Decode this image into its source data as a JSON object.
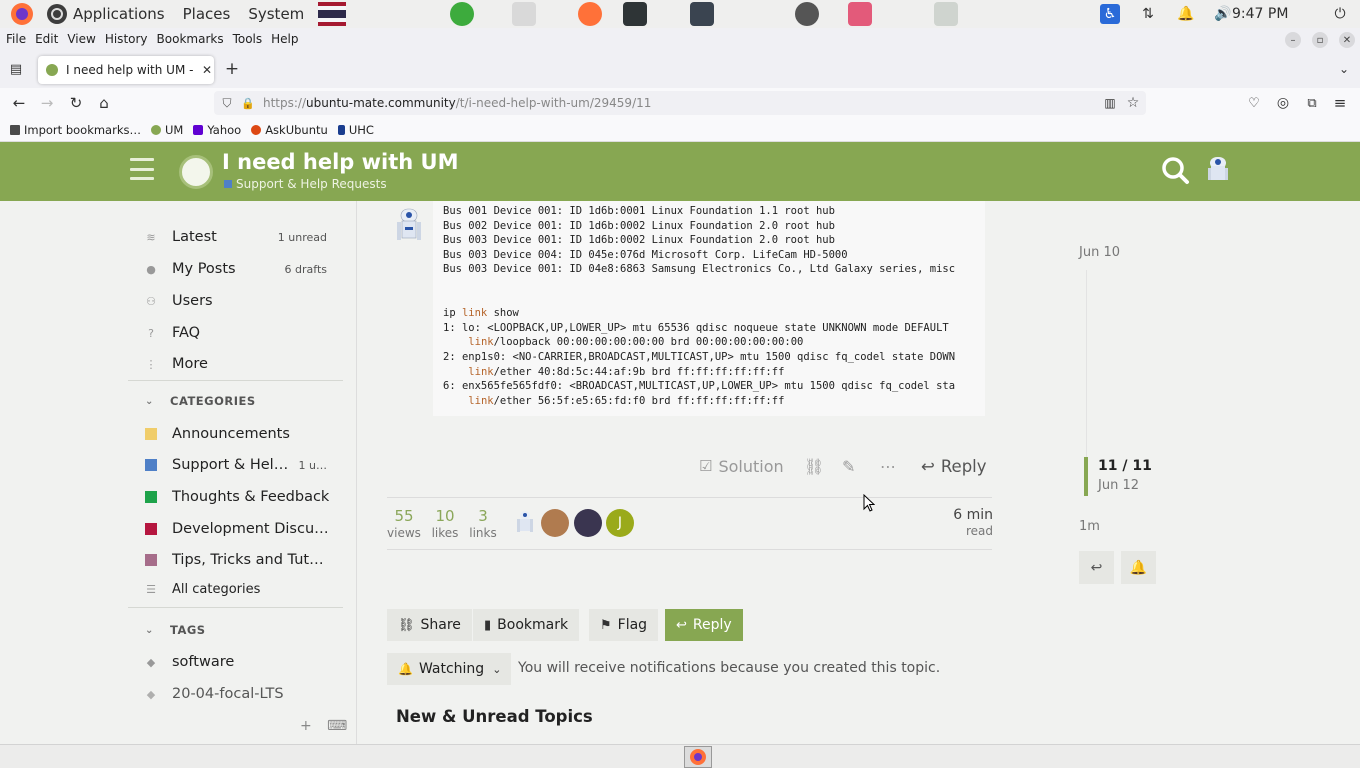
{
  "system_panel": {
    "menus": [
      "Applications",
      "Places",
      "System"
    ],
    "clock": "9:47 PM",
    "launchers": [
      "screen-switcher-icon",
      "sensors-icon",
      "firefox-icon",
      "terminal-icon",
      "system-monitor-icon",
      "software-updater-icon",
      "usb-creator-icon",
      "recycle-icon"
    ],
    "tray": [
      "accessibility-icon",
      "network-icon",
      "notifications-icon",
      "volume-icon",
      "power-icon"
    ]
  },
  "firefox": {
    "menubar": [
      "File",
      "Edit",
      "View",
      "History",
      "Bookmarks",
      "Tools",
      "Help"
    ],
    "tab_title": "I need help with UM - Support & Help Requests",
    "url_prefix": "https://",
    "url_domain": "ubuntu-mate.community",
    "url_path": "/t/i-need-help-with-um/29459/11",
    "bookmarks": [
      {
        "label": "Import bookmarks…",
        "color": "#4a4a4a"
      },
      {
        "label": "UM",
        "color": "#87a752"
      },
      {
        "label": "Yahoo",
        "color": "#6001d2"
      },
      {
        "label": "AskUbuntu",
        "color": "#dd4814"
      },
      {
        "label": "UHC",
        "color": "#1a3d8f"
      }
    ]
  },
  "header": {
    "title": "I need help with UM",
    "category": "Support & Help Requests",
    "accent": "#87a752"
  },
  "sidebar": {
    "items": [
      {
        "label": "Latest",
        "count": "1 unread",
        "icon": "layers-icon"
      },
      {
        "label": "My Posts",
        "count": "6 drafts",
        "icon": "user-icon"
      },
      {
        "label": "Users",
        "count": "",
        "icon": "users-icon"
      },
      {
        "label": "FAQ",
        "count": "",
        "icon": "question-icon"
      },
      {
        "label": "More",
        "count": "",
        "icon": "ellipsis-vertical-icon"
      }
    ],
    "categories_label": "CATEGORIES",
    "categories": [
      {
        "label": "Announcements",
        "color": "#f0cd6a",
        "count": ""
      },
      {
        "label": "Support & Help Requests",
        "color": "#4f80c7",
        "count": "1 u…"
      },
      {
        "label": "Thoughts & Feedback",
        "color": "#1ea34a",
        "count": ""
      },
      {
        "label": "Development Discussion",
        "color": "#b5163f",
        "count": ""
      },
      {
        "label": "Tips, Tricks and Tutorials",
        "color": "#a66d8a",
        "count": ""
      }
    ],
    "all_categories": "All categories",
    "tags_label": "TAGS",
    "tags": [
      "software",
      "20-04-focal-LTS"
    ]
  },
  "post": {
    "code_lines": [
      "Bus 001 Device 001: ID 1d6b:0001 Linux Foundation 1.1 root hub",
      "Bus 002 Device 001: ID 1d6b:0002 Linux Foundation 2.0 root hub",
      "Bus 003 Device 001: ID 1d6b:0002 Linux Foundation 2.0 root hub",
      "Bus 003 Device 004: ID 045e:076d Microsoft Corp. LifeCam HD-5000",
      "Bus 003 Device 001: ID 04e8:6863 Samsung Electronics Co., Ltd Galaxy series, misc",
      "",
      "",
      "ip link show",
      "1: lo: <LOOPBACK,UP,LOWER_UP> mtu 65536 qdisc noqueue state UNKNOWN mode DEFAULT",
      "    link/loopback 00:00:00:00:00:00 brd 00:00:00:00:00:00",
      "2: enp1s0: <NO-CARRIER,BROADCAST,MULTICAST,UP> mtu 1500 qdisc fq_codel state DOWN",
      "    link/ether 40:8d:5c:44:af:9b brd ff:ff:ff:ff:ff:ff",
      "6: enx565fe565fdf0: <BROADCAST,MULTICAST,UP,LOWER_UP> mtu 1500 qdisc fq_codel sta",
      "    link/ether 56:5f:e5:65:fd:f0 brd ff:ff:ff:ff:ff:ff"
    ],
    "actions": {
      "solution": "Solution",
      "reply": "Reply"
    }
  },
  "topic_map": {
    "stats": [
      {
        "num": "55",
        "label": "views"
      },
      {
        "num": "10",
        "label": "likes"
      },
      {
        "num": "3",
        "label": "links"
      }
    ],
    "participants": [
      "#e7eef7",
      "#b07b4f",
      "#3a3550",
      "#9aaa1a"
    ],
    "participant_initial": "J",
    "read_time_value": "6 min",
    "read_time_label": "read"
  },
  "footer_buttons": {
    "share": "Share",
    "bookmark": "Bookmark",
    "flag": "Flag",
    "reply": "Reply",
    "watching": "Watching",
    "notification_text": "You will receive notifications because you created this topic."
  },
  "suggested_heading": "New & Unread Topics",
  "timeline": {
    "start_date": "Jun 10",
    "position": "11 / 11",
    "position_date": "Jun 12",
    "end_age": "1m"
  }
}
